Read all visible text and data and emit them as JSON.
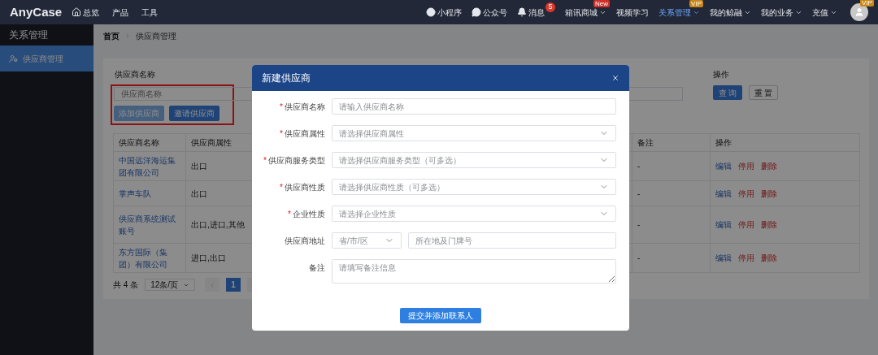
{
  "header": {
    "logo": "AnyCase",
    "nav_left": [
      {
        "label": "总览",
        "kind": "home",
        "selected": false
      },
      {
        "label": "产品",
        "kind": "plain",
        "selected": false
      },
      {
        "label": "工具",
        "kind": "plain",
        "selected": false
      }
    ],
    "nav_right": [
      {
        "label": "小程序",
        "kind": "mini",
        "dropdown": false,
        "selected": false
      },
      {
        "label": "公众号",
        "kind": "wechat",
        "dropdown": false,
        "selected": false
      },
      {
        "label": "消息",
        "kind": "bell",
        "badge": "5",
        "dropdown": false,
        "selected": false
      },
      {
        "label": "箱讯商城",
        "kind": "plain",
        "tag": "New",
        "dropdown": true,
        "selected": false
      },
      {
        "label": "视频学习",
        "kind": "plain",
        "dropdown": false,
        "selected": false
      },
      {
        "label": "关系管理",
        "kind": "plain",
        "tag": "VIP",
        "dropdown": true,
        "selected": true
      },
      {
        "label": "我的鲸融",
        "kind": "plain",
        "dropdown": true,
        "selected": false
      },
      {
        "label": "我的业务",
        "kind": "plain",
        "dropdown": true,
        "selected": false
      },
      {
        "label": "充值",
        "kind": "plain",
        "dropdown": true,
        "selected": false
      }
    ],
    "avatar_tag": "VIP"
  },
  "sidebar": {
    "title": "关系管理",
    "items": [
      {
        "label": "供应商管理",
        "selected": true
      }
    ]
  },
  "breadcrumb": [
    "首页",
    "供应商管理"
  ],
  "filter": {
    "label": "供应商名称",
    "placeholder": "供应商名称",
    "highlighted": true,
    "add_button": "添加供应商",
    "invite_button": "邀请供应商",
    "actions_label": "操作",
    "query_button": "查 询",
    "reset_button": "重 置"
  },
  "table": {
    "columns": [
      "供应商名称",
      "供应商属性",
      "备注",
      "操作"
    ],
    "rows": [
      {
        "name": "中国远洋海运集团有限公司",
        "attribute": "出口",
        "remark": "-",
        "actions": [
          {
            "label": "编辑",
            "kind": "edit"
          },
          {
            "label": "停用",
            "kind": "danger"
          },
          {
            "label": "删除",
            "kind": "danger"
          }
        ]
      },
      {
        "name": "掌声车队",
        "attribute": "出口",
        "remark": "-",
        "actions": [
          {
            "label": "编辑",
            "kind": "edit"
          },
          {
            "label": "停用",
            "kind": "danger"
          },
          {
            "label": "删除",
            "kind": "danger"
          }
        ]
      },
      {
        "name": "供应商系统测试账号",
        "attribute": "出口,进口,其他",
        "remark": "-",
        "actions": [
          {
            "label": "编辑",
            "kind": "edit"
          },
          {
            "label": "停用",
            "kind": "danger"
          },
          {
            "label": "删除",
            "kind": "danger"
          }
        ]
      },
      {
        "name": "东方国际（集团）有限公司",
        "attribute": "进口,出口",
        "remark": "-",
        "actions": [
          {
            "label": "编辑",
            "kind": "edit"
          },
          {
            "label": "停用",
            "kind": "danger"
          },
          {
            "label": "删除",
            "kind": "danger"
          }
        ]
      }
    ]
  },
  "pagination": {
    "total": "共 4 条",
    "page_size": "12条/页",
    "pages": [
      {
        "label": "1",
        "selected": true
      }
    ]
  },
  "modal": {
    "title": "新建供应商",
    "required_mark": "*",
    "fields": [
      {
        "label": "供应商名称",
        "required": true,
        "kind": "input",
        "placeholder": "请输入供应商名称"
      },
      {
        "label": "供应商属性",
        "required": true,
        "kind": "select",
        "placeholder": "请选择供应商属性"
      },
      {
        "label": "供应商服务类型",
        "required": true,
        "kind": "select",
        "placeholder": "请选择供应商服务类型（可多选）"
      },
      {
        "label": "供应商性质",
        "required": true,
        "kind": "select",
        "placeholder": "请选择供应商性质（可多选）"
      },
      {
        "label": "企业性质",
        "required": true,
        "kind": "select",
        "placeholder": "请选择企业性质"
      },
      {
        "label": "供应商地址",
        "required": false,
        "kind": "address",
        "placeholder": "省/市/区",
        "placeholder2": "所在地及门牌号"
      },
      {
        "label": "备注",
        "required": false,
        "kind": "textarea",
        "placeholder": "请填写备注信息"
      }
    ],
    "submit_button": "提交并添加联系人"
  }
}
